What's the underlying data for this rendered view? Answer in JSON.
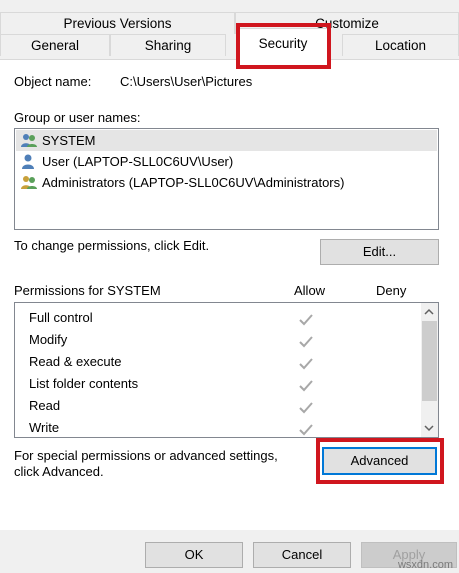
{
  "tabs": {
    "previous_versions": "Previous Versions",
    "customize": "Customize",
    "general": "General",
    "sharing": "Sharing",
    "security": "Security",
    "location": "Location"
  },
  "object": {
    "label": "Object name:",
    "value": "C:\\Users\\User\\Pictures"
  },
  "group": {
    "label": "Group or user names:",
    "items": [
      {
        "name": "SYSTEM"
      },
      {
        "name": "User (LAPTOP-SLL0C6UV\\User)"
      },
      {
        "name": "Administrators (LAPTOP-SLL0C6UV\\Administrators)"
      }
    ]
  },
  "change_text": "To change permissions, click Edit.",
  "edit_button": "Edit...",
  "permissions": {
    "label": "Permissions for SYSTEM",
    "allow_header": "Allow",
    "deny_header": "Deny",
    "rows": [
      "Full control",
      "Modify",
      "Read & execute",
      "List folder contents",
      "Read",
      "Write"
    ]
  },
  "special": {
    "line1": "For special permissions or advanced settings,",
    "line2": "click Advanced."
  },
  "advanced_button": "Advanced",
  "footer": {
    "ok": "OK",
    "cancel": "Cancel",
    "apply": "Apply"
  },
  "watermark": "wsxdn.com",
  "colors": {
    "highlight": "#d0161e",
    "focus": "#0078d7",
    "selection": "#e5e5e5"
  }
}
